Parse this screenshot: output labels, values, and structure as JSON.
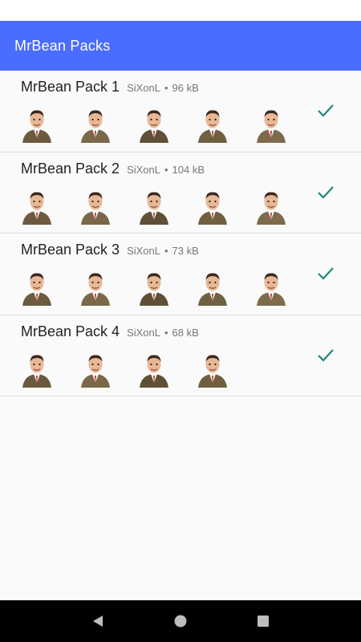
{
  "app_bar": {
    "title": "MrBean Packs"
  },
  "packs": [
    {
      "name": "MrBean Pack 1",
      "author": "SiXonL",
      "size": "96 kB",
      "sticker_count": 5,
      "added": true
    },
    {
      "name": "MrBean Pack 2",
      "author": "SiXonL",
      "size": "104 kB",
      "sticker_count": 5,
      "added": true
    },
    {
      "name": "MrBean Pack 3",
      "author": "SiXonL",
      "size": "73 kB",
      "sticker_count": 5,
      "added": true
    },
    {
      "name": "MrBean Pack 4",
      "author": "SiXonL",
      "size": "68 kB",
      "sticker_count": 4,
      "added": true
    }
  ],
  "icons": {
    "added": "checkmark-icon",
    "nav_back": "back-triangle-icon",
    "nav_home": "home-circle-icon",
    "nav_recents": "recents-square-icon"
  },
  "colors": {
    "app_bar": "#4a6cff",
    "check": "#1a8a78",
    "nav_bar": "#000000"
  },
  "dot_separator": "•"
}
